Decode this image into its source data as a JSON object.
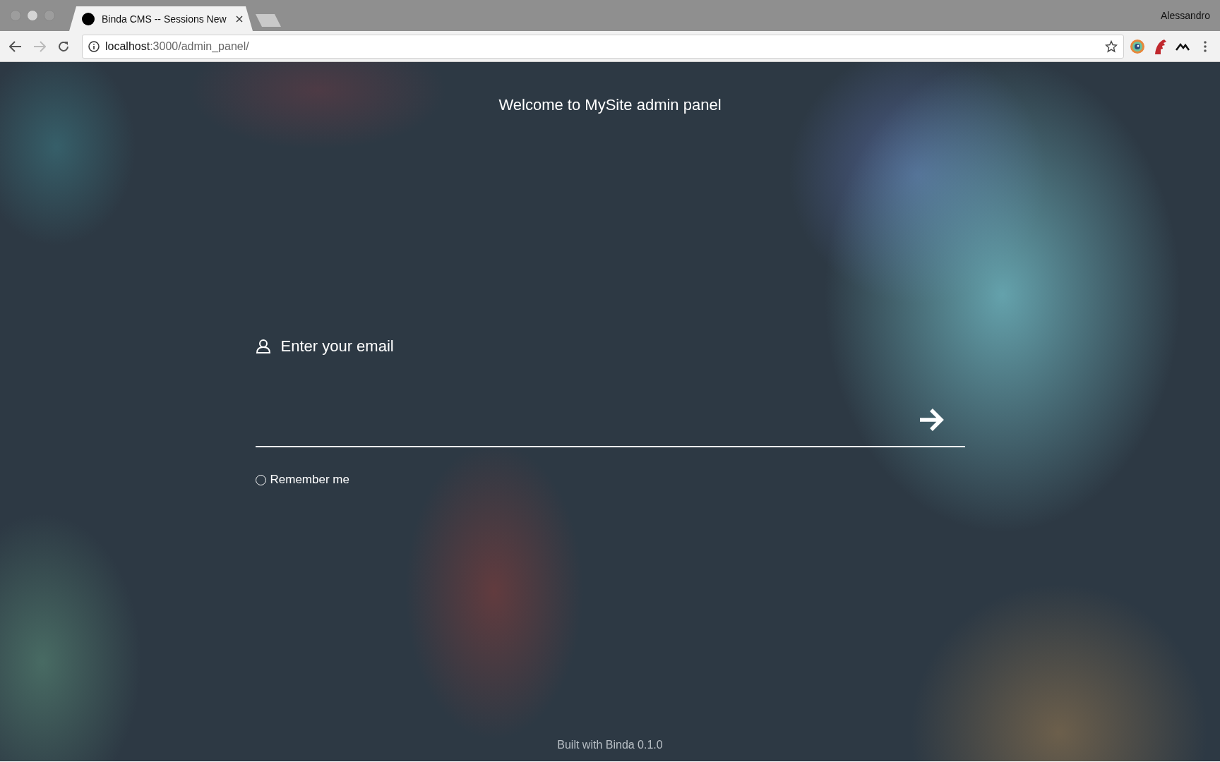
{
  "browser": {
    "tab": {
      "title": "Binda CMS -- Sessions New",
      "selected": true
    },
    "profile": "Alessandro",
    "url": {
      "host": "localhost",
      "path": ":3000/admin_panel/"
    }
  },
  "page": {
    "heading": "Welcome to MySite admin panel",
    "email_label": "Enter your email",
    "remember": {
      "label": "Remember me",
      "checked": false
    },
    "footer": "Built with Binda 0.1.0"
  }
}
